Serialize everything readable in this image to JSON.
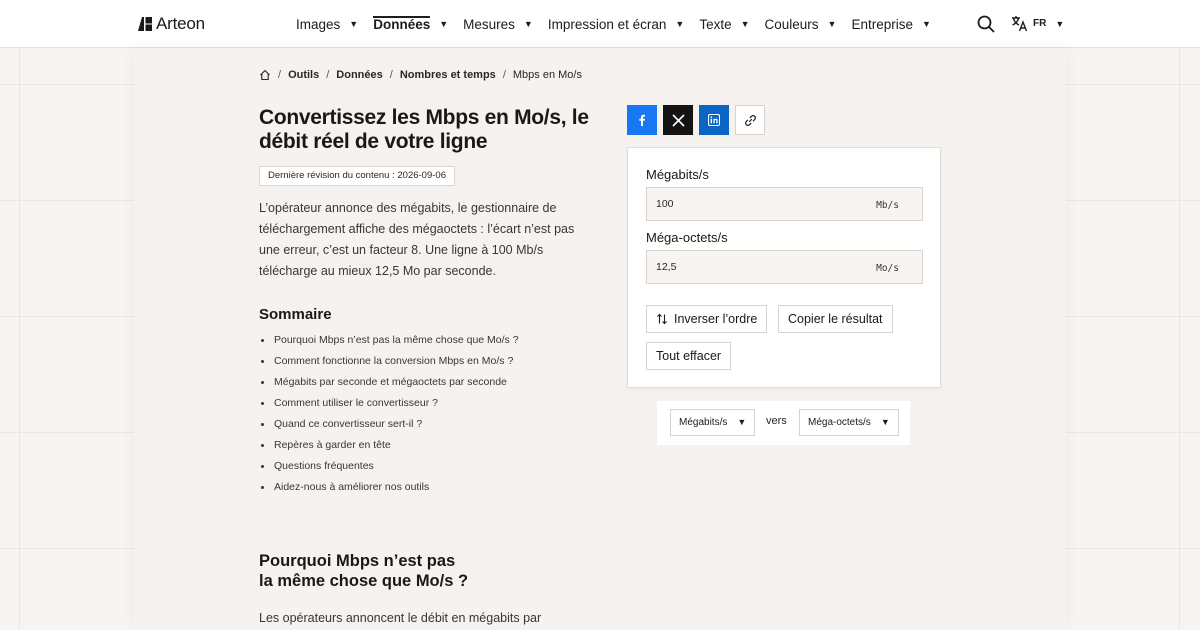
{
  "header": {
    "brand": "Arteon",
    "nav": [
      {
        "label": "Images"
      },
      {
        "label": "Données",
        "active": true
      },
      {
        "label": "Mesures"
      },
      {
        "label": "Impression et écran"
      },
      {
        "label": "Texte"
      },
      {
        "label": "Couleurs"
      },
      {
        "label": "Entreprise"
      }
    ],
    "lang": "FR"
  },
  "breadcrumb": {
    "items": [
      "Outils",
      "Données",
      "Nombres et temps",
      "Mbps en Mo/s"
    ]
  },
  "article": {
    "title": "Convertissez les Mbps en Mo/s, le débit réel de votre ligne",
    "revision": "Dernière révision du contenu : 2026-09-06",
    "intro": "L’opérateur annonce des mégabits, le gestionnaire de téléchargement affiche des mégaoctets : l’écart n’est pas une erreur, c’est un facteur 8. Une ligne à 100 Mb/s télécharge au mieux 12,5 Mo par seconde.",
    "toc_title": "Sommaire",
    "toc": [
      "Pourquoi Mbps n’est pas la même chose que Mo/s ?",
      "Comment fonctionne la conversion Mbps en Mo/s ?",
      "Mégabits par seconde et mégaoctets par seconde",
      "Comment utiliser le convertisseur ?",
      "Quand ce convertisseur sert-il ?",
      "Repères à garder en tête",
      "Questions fréquentes",
      "Aidez-nous à améliorer nos outils"
    ],
    "section_title_line1": "Pourquoi Mbps n’est pas",
    "section_title_line2": "la même chose que Mo/s ?",
    "section_text": "Les opérateurs annoncent le débit en mégabits par"
  },
  "converter": {
    "from_label": "Mégabits/s",
    "from_value": "100",
    "from_unit": "Mb/s",
    "to_label": "Méga-octets/s",
    "to_value": "12,5",
    "to_unit": "Mo/s",
    "swap_label": "Inverser l’ordre",
    "copy_label": "Copier le résultat",
    "clear_label": "Tout effacer"
  },
  "unit_selector": {
    "from": "Mégabits/s",
    "connector": "vers",
    "to": "Méga-octets/s"
  },
  "colors": {
    "facebook": "#1877f2",
    "x": "#141414",
    "linkedin": "#0a66c2"
  }
}
